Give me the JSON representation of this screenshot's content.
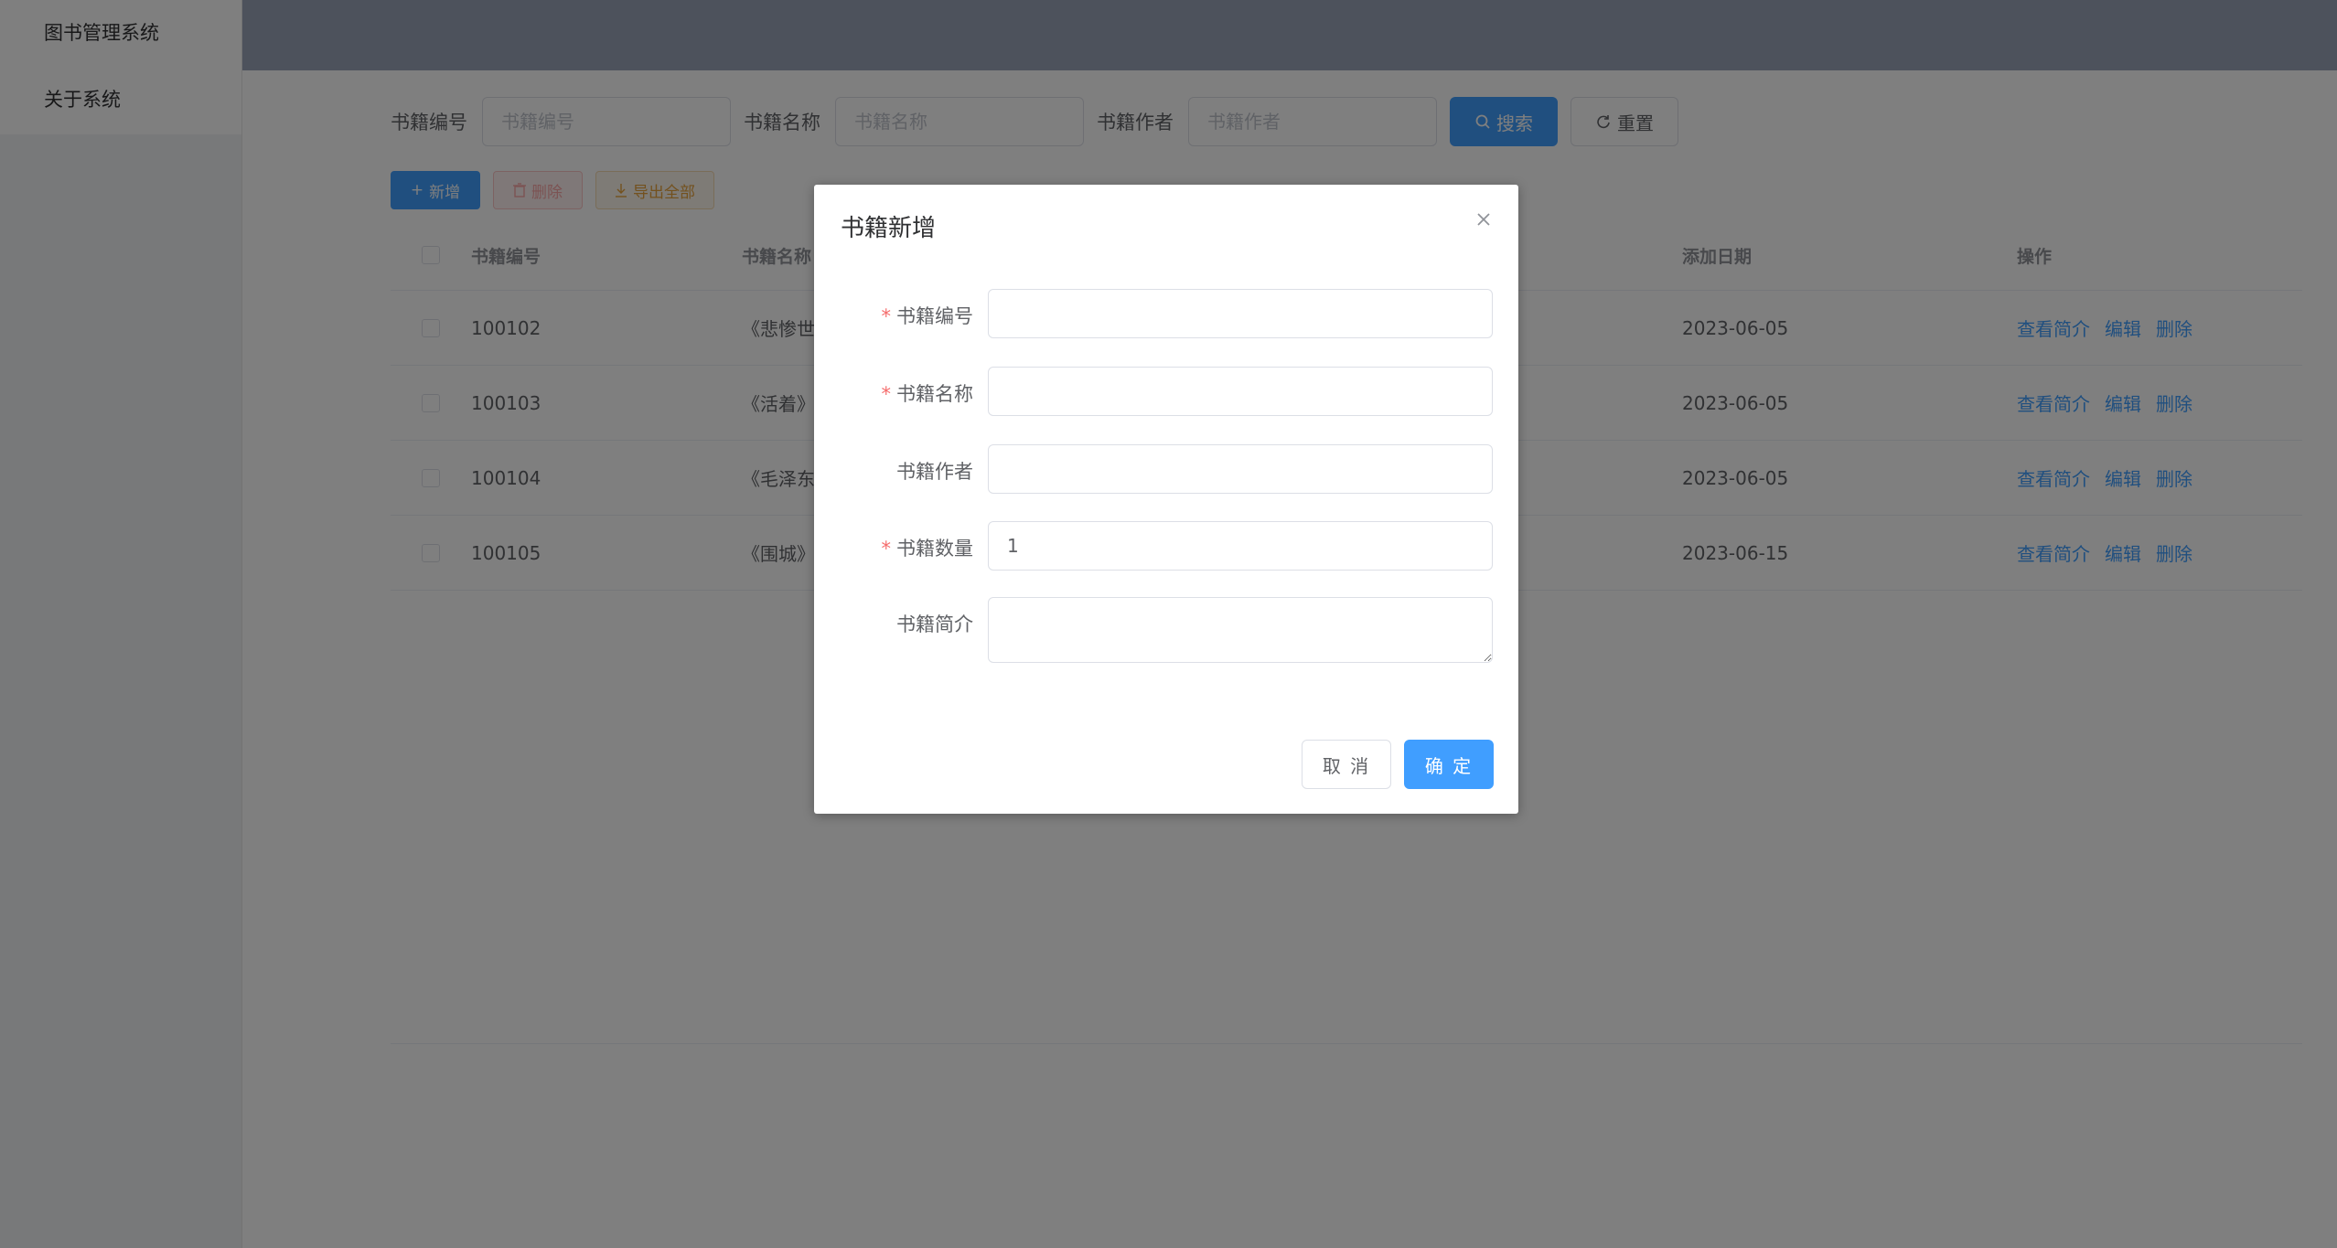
{
  "sidebar": {
    "items": [
      {
        "label": "图书管理系统"
      },
      {
        "label": "关于系统"
      }
    ]
  },
  "search": {
    "book_id_label": "书籍编号",
    "book_id_placeholder": "书籍编号",
    "book_name_label": "书籍名称",
    "book_name_placeholder": "书籍名称",
    "book_author_label": "书籍作者",
    "book_author_placeholder": "书籍作者",
    "search_button": "搜索",
    "reset_button": "重置"
  },
  "toolbar": {
    "add_label": "新增",
    "delete_label": "删除",
    "export_label": "导出全部"
  },
  "table": {
    "headers": {
      "id": "书籍编号",
      "name": "书籍名称",
      "date": "添加日期",
      "ops": "操作"
    },
    "rows": [
      {
        "id": "100102",
        "name": "《悲惨世",
        "date": "2023-06-05"
      },
      {
        "id": "100103",
        "name": "《活着》",
        "date": "2023-06-05"
      },
      {
        "id": "100104",
        "name": "《毛泽东",
        "date": "2023-06-05"
      },
      {
        "id": "100105",
        "name": "《围城》",
        "date": "2023-06-15"
      }
    ],
    "actions": {
      "view": "查看简介",
      "edit": "编辑",
      "delete": "删除"
    }
  },
  "dialog": {
    "title": "书籍新增",
    "required_mark": "*",
    "fields": {
      "book_id": {
        "label": "书籍编号",
        "value": ""
      },
      "book_name": {
        "label": "书籍名称",
        "value": ""
      },
      "book_author": {
        "label": "书籍作者",
        "value": ""
      },
      "book_count": {
        "label": "书籍数量",
        "value": "1"
      },
      "book_intro": {
        "label": "书籍简介",
        "value": ""
      }
    },
    "cancel_label": "取 消",
    "confirm_label": "确 定"
  },
  "colors": {
    "primary": "#409eff",
    "danger": "#f56c6c",
    "warning": "#e6a23c",
    "topbar": "#9aa5b8"
  },
  "icons": [
    "search-icon",
    "refresh-icon",
    "plus-icon",
    "trash-icon",
    "download-icon",
    "close-icon"
  ]
}
